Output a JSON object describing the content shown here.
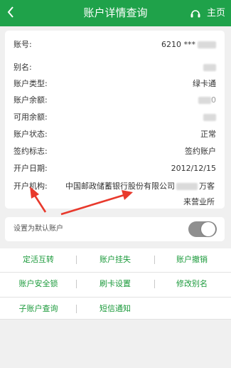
{
  "header": {
    "title": "账户详情查询",
    "home_label": "主页",
    "back_icon": "chevron-left-icon",
    "home_icon": "headset-icon",
    "color": "#1fa24a"
  },
  "details": [
    {
      "label": "账号:",
      "value": "6210 ***"
    },
    {
      "label": "别名:",
      "value": ""
    },
    {
      "label": "账户类型:",
      "value": "绿卡通"
    },
    {
      "label": "账户余额:",
      "value": "0"
    },
    {
      "label": "可用余额:",
      "value": ""
    },
    {
      "label": "账户状态:",
      "value": "正常"
    },
    {
      "label": "签约标志:",
      "value": "签约账户"
    },
    {
      "label": "开户日期:",
      "value": "2012/12/15"
    }
  ],
  "branch": {
    "label": "开户机构:",
    "line1_prefix": "中国邮政储蓄银行股份有限公司",
    "line1_suffix": "万客",
    "line2": "来营业所"
  },
  "default_toggle": {
    "label": "设置为默认账户",
    "state": "off"
  },
  "actions": [
    [
      "定活互转",
      "账户挂失",
      "账户撤销"
    ],
    [
      "账户安全锁",
      "刷卡设置",
      "修改别名"
    ],
    [
      "子账户查询",
      "短信通知"
    ]
  ],
  "annotation": {
    "arrow_color": "#e8392c"
  }
}
